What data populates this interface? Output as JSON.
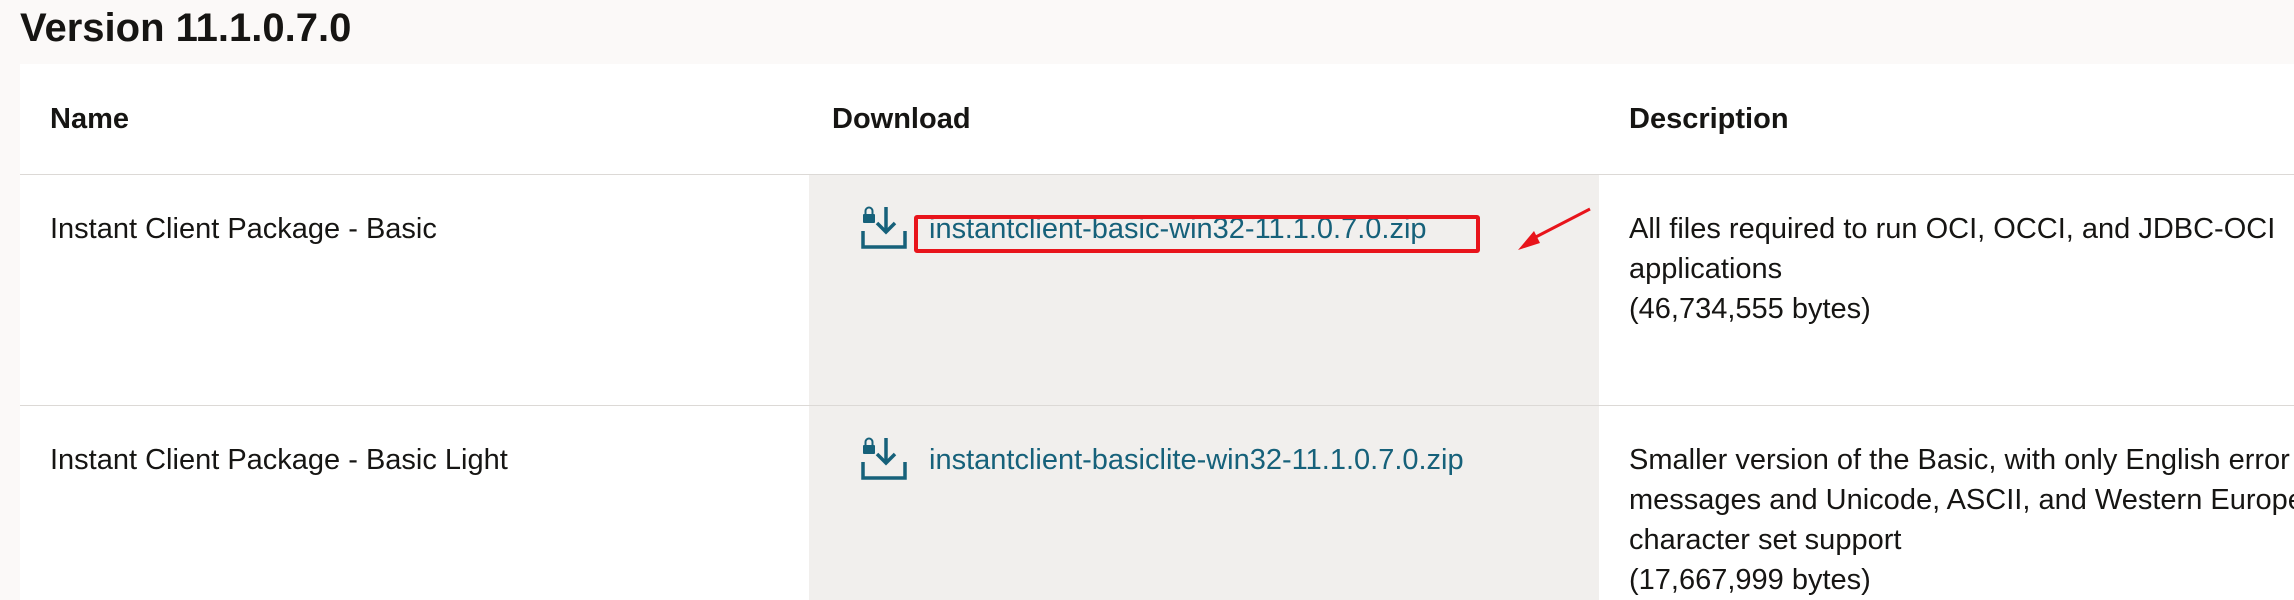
{
  "section": {
    "title": "Version 11.1.0.7.0"
  },
  "table": {
    "headers": {
      "name": "Name",
      "download": "Download",
      "description": "Description"
    },
    "rows": [
      {
        "name": "Instant Client Package - Basic",
        "file": "instantclient-basic-win32-11.1.0.7.0.zip",
        "description_lines": [
          "All files required to run OCI, OCCI, and JDBC-OCI",
          "applications",
          "(46,734,555 bytes)"
        ]
      },
      {
        "name": "Instant Client Package - Basic Light",
        "file": "instantclient-basiclite-win32-11.1.0.7.0.zip",
        "description_lines": [
          "Smaller version of the Basic, with only English error",
          "messages and Unicode, ASCII, and Western European",
          "character set support",
          "(17,667,999 bytes)"
        ]
      }
    ]
  },
  "icons": {
    "download": "download-lock-icon",
    "annotation_arrow": "arrow-icon"
  },
  "colors": {
    "link": "#16617a",
    "highlight": "#e8141b",
    "download_column_bg": "#f1efed"
  }
}
